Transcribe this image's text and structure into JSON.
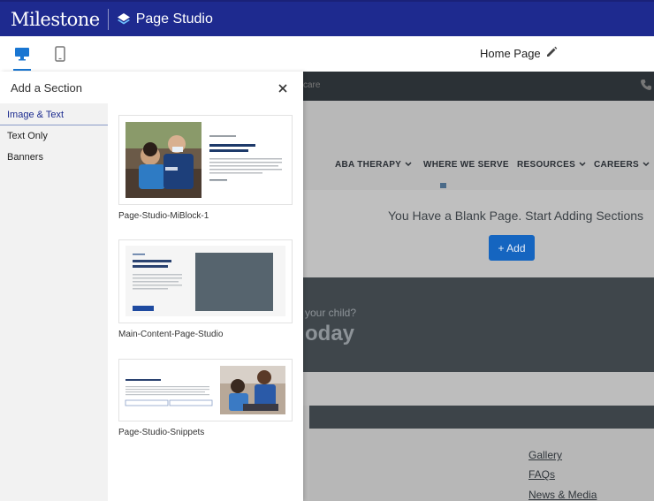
{
  "brand": {
    "name": "Milestone",
    "product": "Page Studio"
  },
  "toolbar": {
    "page_name": "Home Page",
    "devices": [
      "desktop",
      "mobile"
    ]
  },
  "panel": {
    "title": "Add a Section",
    "categories": [
      {
        "label": "Image & Text",
        "active": true
      },
      {
        "label": "Text Only",
        "active": false
      },
      {
        "label": "Banners",
        "active": false
      }
    ],
    "cards": [
      {
        "label": "Page-Studio-MiBlock-1",
        "thumb_title": "Your Child's Safety Is Our #1 Priority"
      },
      {
        "label": "Main-Content-Page-Studio",
        "thumb_title": "Page H1 Headline: Sed ut perspiciatis"
      },
      {
        "label": "Page-Studio-Snippets",
        "thumb_title": "ABA Therapy Settings"
      }
    ]
  },
  "preview": {
    "topstrip_text": "care",
    "nav": [
      "ABA THERAPY",
      "WHERE WE SERVE",
      "RESOURCES",
      "CAREERS"
    ],
    "blank_message": "You Have a Blank Page. Start Adding Sections",
    "add_label": "+ Add",
    "cta_line1": "your child?",
    "cta_line2": "oday",
    "footer_links": [
      "Gallery",
      "FAQs",
      "News & Media"
    ]
  },
  "colors": {
    "brand_bar": "#1e2a8f",
    "accent": "#1976d2",
    "add_button": "#1565c0"
  }
}
